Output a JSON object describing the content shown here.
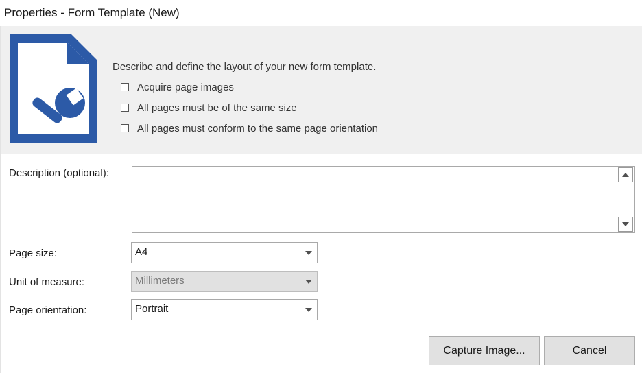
{
  "window": {
    "title": "Properties - Form Template (New)"
  },
  "header": {
    "icon": "document-wrench-icon",
    "description": "Describe and define the layout of your new form template.",
    "requirements": [
      "Acquire page images",
      "All pages must be of the same size",
      "All pages must conform to the same page orientation"
    ]
  },
  "form": {
    "description_label": "Description (optional):",
    "description_value": "",
    "page_size_label": "Page size:",
    "page_size_value": "A4",
    "unit_label": "Unit of measure:",
    "unit_value": "Millimeters",
    "orientation_label": "Page orientation:",
    "orientation_value": "Portrait"
  },
  "buttons": {
    "capture": "Capture Image...",
    "cancel": "Cancel"
  },
  "colors": {
    "icon_blue": "#2c5aa7",
    "header_bg": "#f0f0f0",
    "button_bg": "#e1e1e1"
  }
}
